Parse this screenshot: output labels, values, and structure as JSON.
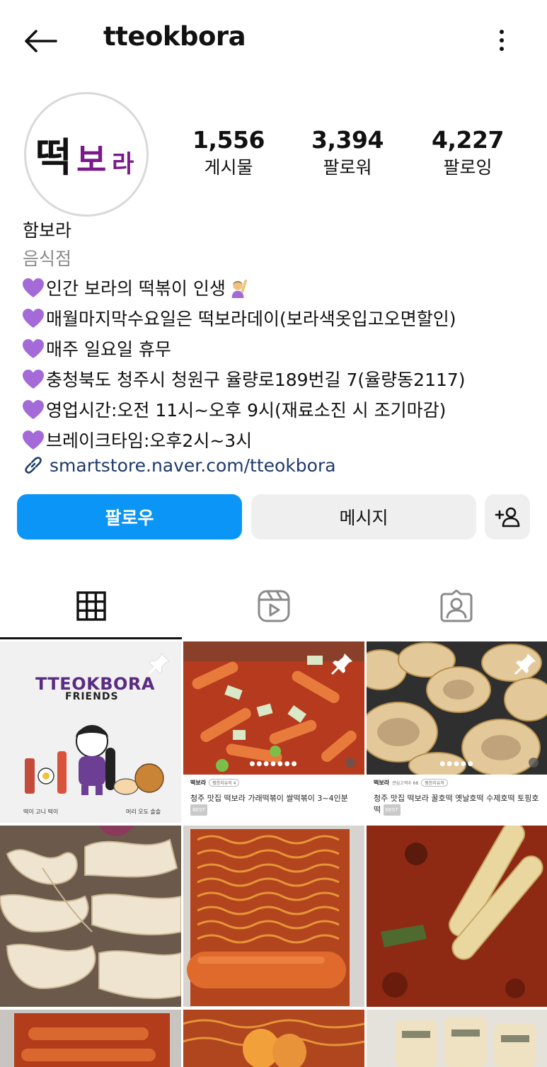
{
  "header": {
    "username": "tteokbora",
    "back_icon": "arrow-left-icon",
    "more_icon": "more-vertical-icon"
  },
  "profile": {
    "avatar_text_1": "떡",
    "avatar_text_2": "보",
    "avatar_text_3": "라",
    "stats": [
      {
        "value": "1,556",
        "label": "게시물"
      },
      {
        "value": "3,394",
        "label": "팔로워"
      },
      {
        "value": "4,227",
        "label": "팔로잉"
      }
    ],
    "name": "함보라",
    "category": "음식점",
    "bio_lines": [
      "인간 보라의 떡볶이 인생",
      "매월마지막수요일은 떡보라데이(보라색옷입고오면할인)",
      "매주 일요일 휴무",
      "충청북도 청주시 청원구 율량로189번길 7(율량동2117)",
      "영업시간:오전 11시~오후 9시(재료소진 시 조기마감)",
      "브레이크타임:오후2시~3시"
    ],
    "link": "smartstore.naver.com/tteokbora"
  },
  "actions": {
    "follow": "팔로우",
    "message": "메시지",
    "add_user_icon": "add-user-icon"
  },
  "tabs": [
    {
      "icon": "grid-icon",
      "active": true
    },
    {
      "icon": "reels-icon",
      "active": false
    },
    {
      "icon": "tagged-icon",
      "active": false
    }
  ],
  "posts": {
    "friends": {
      "title": "TTEOKBORA",
      "subtitle": "FRIENDS",
      "captions": [
        "떡이 고니 떡이",
        "머리 오도 솔솔"
      ]
    },
    "card1": {
      "shop": "떡보라",
      "pill": "찜한지유저 4",
      "title": "청주 맛집 떡보라 가래떡볶이 쌀떡볶이 3~4인분",
      "badge": "BEST"
    },
    "card2": {
      "shop": "떡보라",
      "meta": "관심고객수 68",
      "pill": "찜한지유저",
      "title": "청주 맛집 떡보라 꿀호떡 옛날호떡 수제호떡 토핑호떡",
      "badge": "BEST"
    }
  },
  "colors": {
    "follow_button": "#0b95f6",
    "link": "#1e3a6b",
    "secondary_button": "#efefef",
    "brand_purple": "#7a1a8a"
  }
}
